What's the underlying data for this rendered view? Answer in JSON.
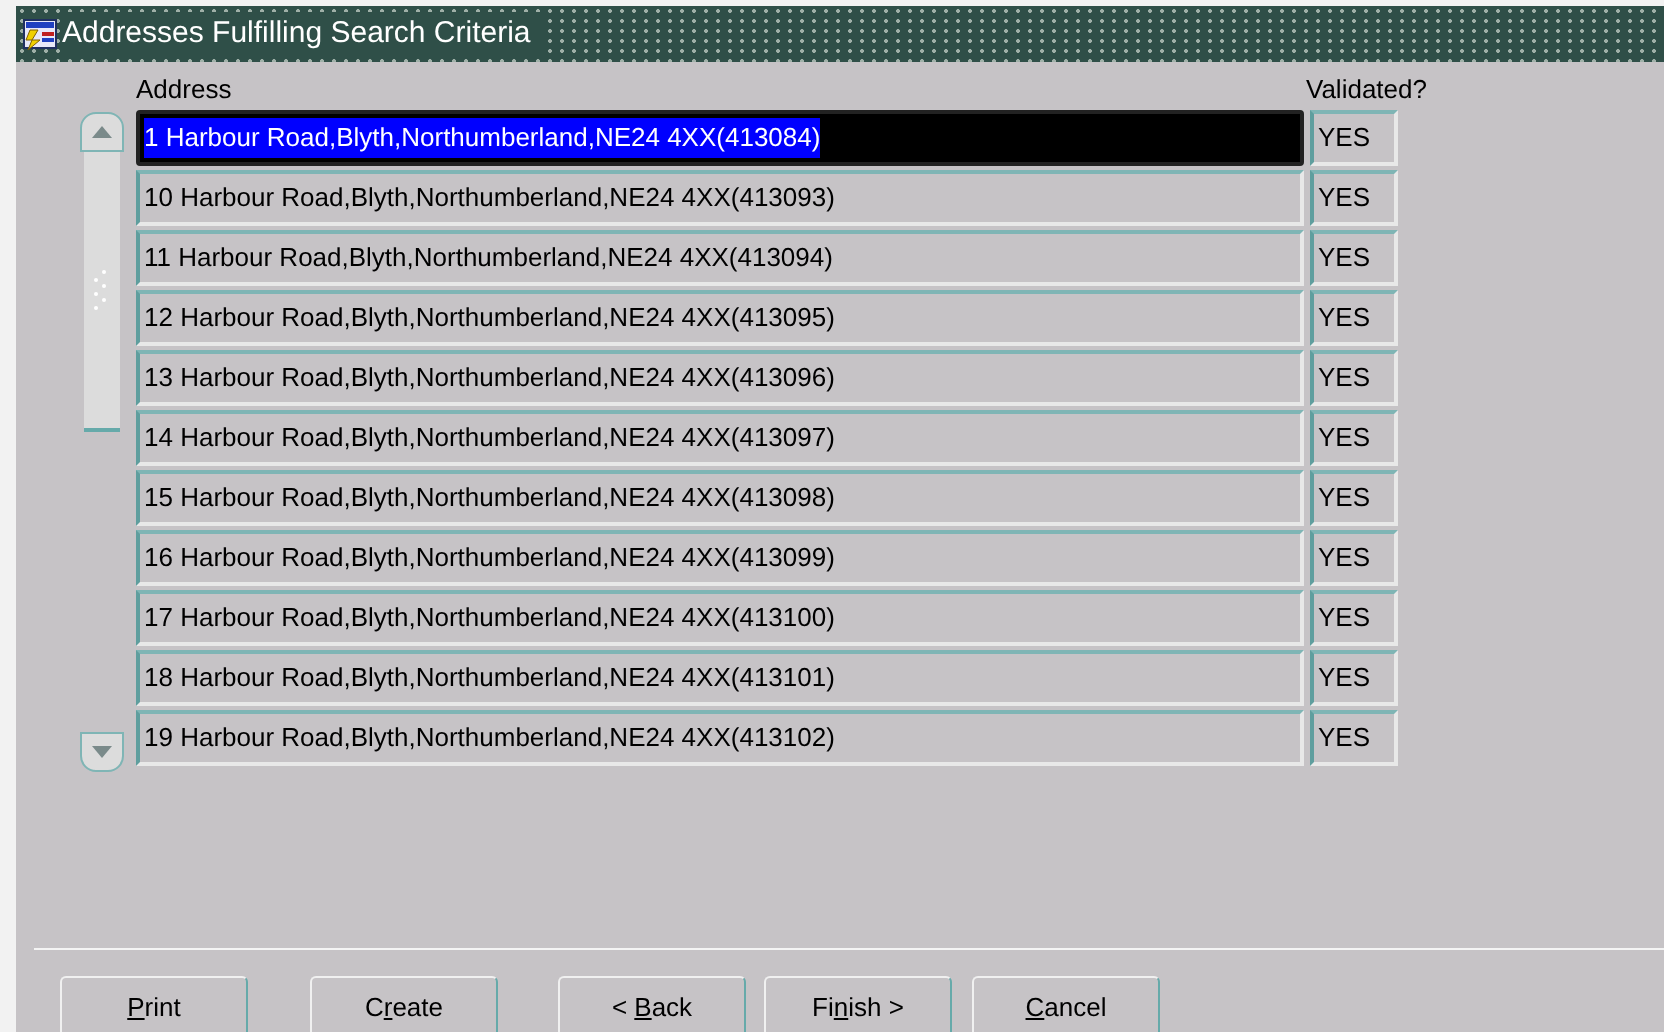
{
  "window": {
    "title": "Addresses Fulfilling Search Criteria"
  },
  "table": {
    "columns": [
      "Address",
      "Validated?"
    ],
    "rows": [
      {
        "address": "1 Harbour Road,Blyth,Northumberland,NE24 4XX(413084)",
        "validated": "YES",
        "selected": true
      },
      {
        "address": "10 Harbour Road,Blyth,Northumberland,NE24 4XX(413093)",
        "validated": "YES",
        "selected": false
      },
      {
        "address": "11 Harbour Road,Blyth,Northumberland,NE24 4XX(413094)",
        "validated": "YES",
        "selected": false
      },
      {
        "address": "12 Harbour Road,Blyth,Northumberland,NE24 4XX(413095)",
        "validated": "YES",
        "selected": false
      },
      {
        "address": "13 Harbour Road,Blyth,Northumberland,NE24 4XX(413096)",
        "validated": "YES",
        "selected": false
      },
      {
        "address": "14 Harbour Road,Blyth,Northumberland,NE24 4XX(413097)",
        "validated": "YES",
        "selected": false
      },
      {
        "address": "15 Harbour Road,Blyth,Northumberland,NE24 4XX(413098)",
        "validated": "YES",
        "selected": false
      },
      {
        "address": "16 Harbour Road,Blyth,Northumberland,NE24 4XX(413099)",
        "validated": "YES",
        "selected": false
      },
      {
        "address": "17 Harbour Road,Blyth,Northumberland,NE24 4XX(413100)",
        "validated": "YES",
        "selected": false
      },
      {
        "address": "18 Harbour Road,Blyth,Northumberland,NE24 4XX(413101)",
        "validated": "YES",
        "selected": false
      },
      {
        "address": "19 Harbour Road,Blyth,Northumberland,NE24 4XX(413102)",
        "validated": "YES",
        "selected": false
      }
    ]
  },
  "buttons": [
    {
      "key": "P",
      "after": "rint"
    },
    {
      "before": "C",
      "key": "r",
      "after": "eate"
    },
    {
      "before": "< ",
      "key": "B",
      "after": "ack"
    },
    {
      "before": "Fi",
      "key": "n",
      "after": "ish >"
    },
    {
      "key": "C",
      "after": "ancel"
    }
  ]
}
